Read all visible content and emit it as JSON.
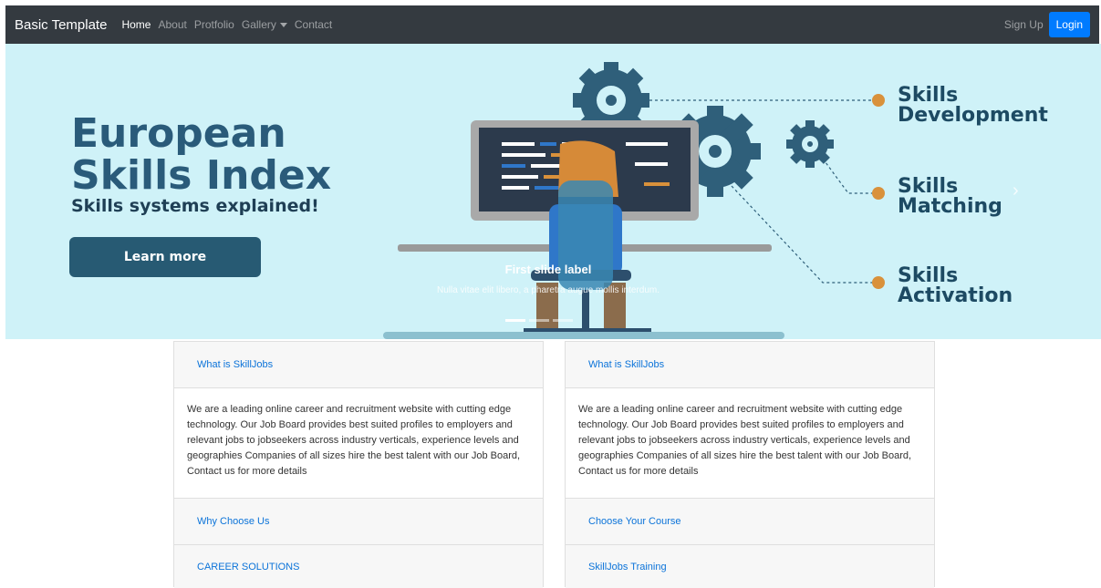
{
  "navbar": {
    "brand": "Basic Template",
    "links": [
      "Home",
      "About",
      "Protfolio",
      "Gallery",
      "Contact"
    ],
    "signup": "Sign Up",
    "login": "Login"
  },
  "hero": {
    "title_line1": "European",
    "title_line2": "Skills Index",
    "subtitle": "Skills systems explained!",
    "button": "Learn more",
    "skills": [
      {
        "line1": "Skills",
        "line2": "Development"
      },
      {
        "line1": "Skills",
        "line2": "Matching"
      },
      {
        "line1": "Skills",
        "line2": "Activation"
      }
    ],
    "caption_title": "First slide label",
    "caption_text": "Nulla vitae elit libero, a pharetra augue mollis interdum."
  },
  "cards": [
    {
      "header": "What is SkillJobs",
      "body": "We are a leading online career and recruitment website with cutting edge technology. Our Job Board provides best suited profiles to employers and relevant jobs to jobseekers across industry verticals, experience levels and geographies Companies of all sizes hire the best talent with our Job Board, Contact us for more details",
      "rows": [
        "Why Choose Us",
        "CAREER SOLUTIONS"
      ]
    },
    {
      "header": "What is SkillJobs",
      "body": "We are a leading online career and recruitment website with cutting edge technology. Our Job Board provides best suited profiles to employers and relevant jobs to jobseekers across industry verticals, experience levels and geographies Companies of all sizes hire the best talent with our Job Board, Contact us for more details",
      "rows": [
        "Choose Your Course",
        "SkillJobs Training"
      ]
    }
  ],
  "colors": {
    "navbar_bg": "#343a40",
    "primary": "#007bff",
    "hero_bg": "#cff2f8",
    "hero_text": "#2a5b7a",
    "link": "#0b73d9"
  }
}
